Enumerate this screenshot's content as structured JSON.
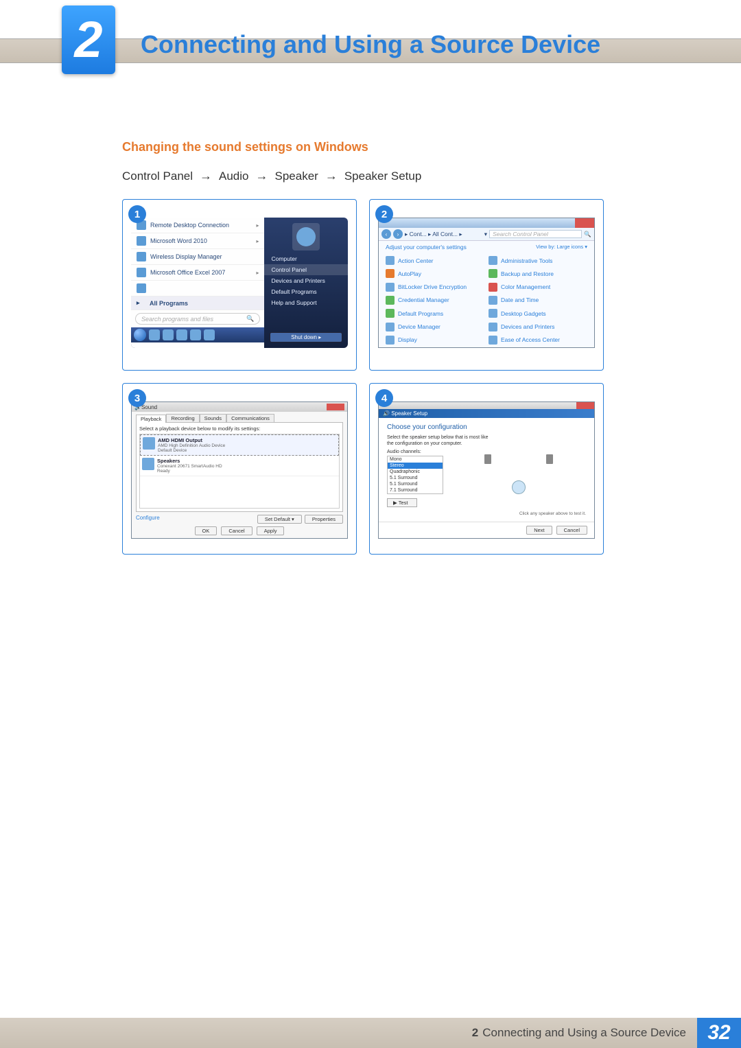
{
  "chapter": {
    "number": "2",
    "title": "Connecting and Using a Source Device"
  },
  "section_heading": "Changing the sound settings on Windows",
  "path": [
    "Control Panel",
    "Audio",
    "Speaker",
    "Speaker Setup"
  ],
  "panel1": {
    "badge": "1",
    "left_apps": [
      "Remote Desktop Connection",
      "Microsoft Word 2010",
      "Wireless Display Manager",
      "Microsoft Office Excel 2007"
    ],
    "all_programs": "All Programs",
    "search_placeholder": "Search programs and files",
    "right_items": [
      "Computer",
      "Control Panel",
      "Devices and Printers",
      "Default Programs",
      "Help and Support"
    ],
    "shutdown": "Shut down"
  },
  "panel2": {
    "badge": "2",
    "breadcrumb": "▸ Cont... ▸ All Cont... ▸",
    "search_placeholder": "Search Control Panel",
    "heading": "Adjust your computer's settings",
    "view_by": "View by:  Large icons ▾",
    "items_left": [
      "Action Center",
      "AutoPlay",
      "BitLocker Drive Encryption",
      "Credential Manager",
      "Default Programs",
      "Device Manager",
      "Display"
    ],
    "items_right": [
      "Administrative Tools",
      "Backup and Restore",
      "Color Management",
      "Date and Time",
      "Desktop Gadgets",
      "Devices and Printers",
      "Ease of Access Center"
    ]
  },
  "panel3": {
    "badge": "3",
    "title": "Sound",
    "tabs": [
      "Playback",
      "Recording",
      "Sounds",
      "Communications"
    ],
    "instruction": "Select a playback device below to modify its settings:",
    "devices": [
      {
        "name": "AMD HDMI Output",
        "line2": "AMD High Definition Audio Device",
        "line3": "Default Device"
      },
      {
        "name": "Speakers",
        "line2": "Conexant 20671 SmartAudio HD",
        "line3": "Ready"
      }
    ],
    "configure": "Configure",
    "set_default": "Set Default",
    "properties": "Properties",
    "ok": "OK",
    "cancel": "Cancel",
    "apply": "Apply"
  },
  "panel4": {
    "badge": "4",
    "band": "Speaker Setup",
    "heading": "Choose your configuration",
    "instruction1": "Select the speaker setup below that is most like",
    "instruction2": "the configuration on your computer.",
    "list_label": "Audio channels:",
    "options": [
      "Mono",
      "Stereo",
      "Quadraphonic",
      "5.1 Surround",
      "5.1 Surround",
      "7.1 Surround"
    ],
    "test": "▶ Test",
    "hint": "Click any speaker above to test it.",
    "next": "Next",
    "cancel": "Cancel"
  },
  "footer": {
    "chapter_ref": "2",
    "chapter_title": "Connecting and Using a Source Device",
    "page": "32"
  }
}
